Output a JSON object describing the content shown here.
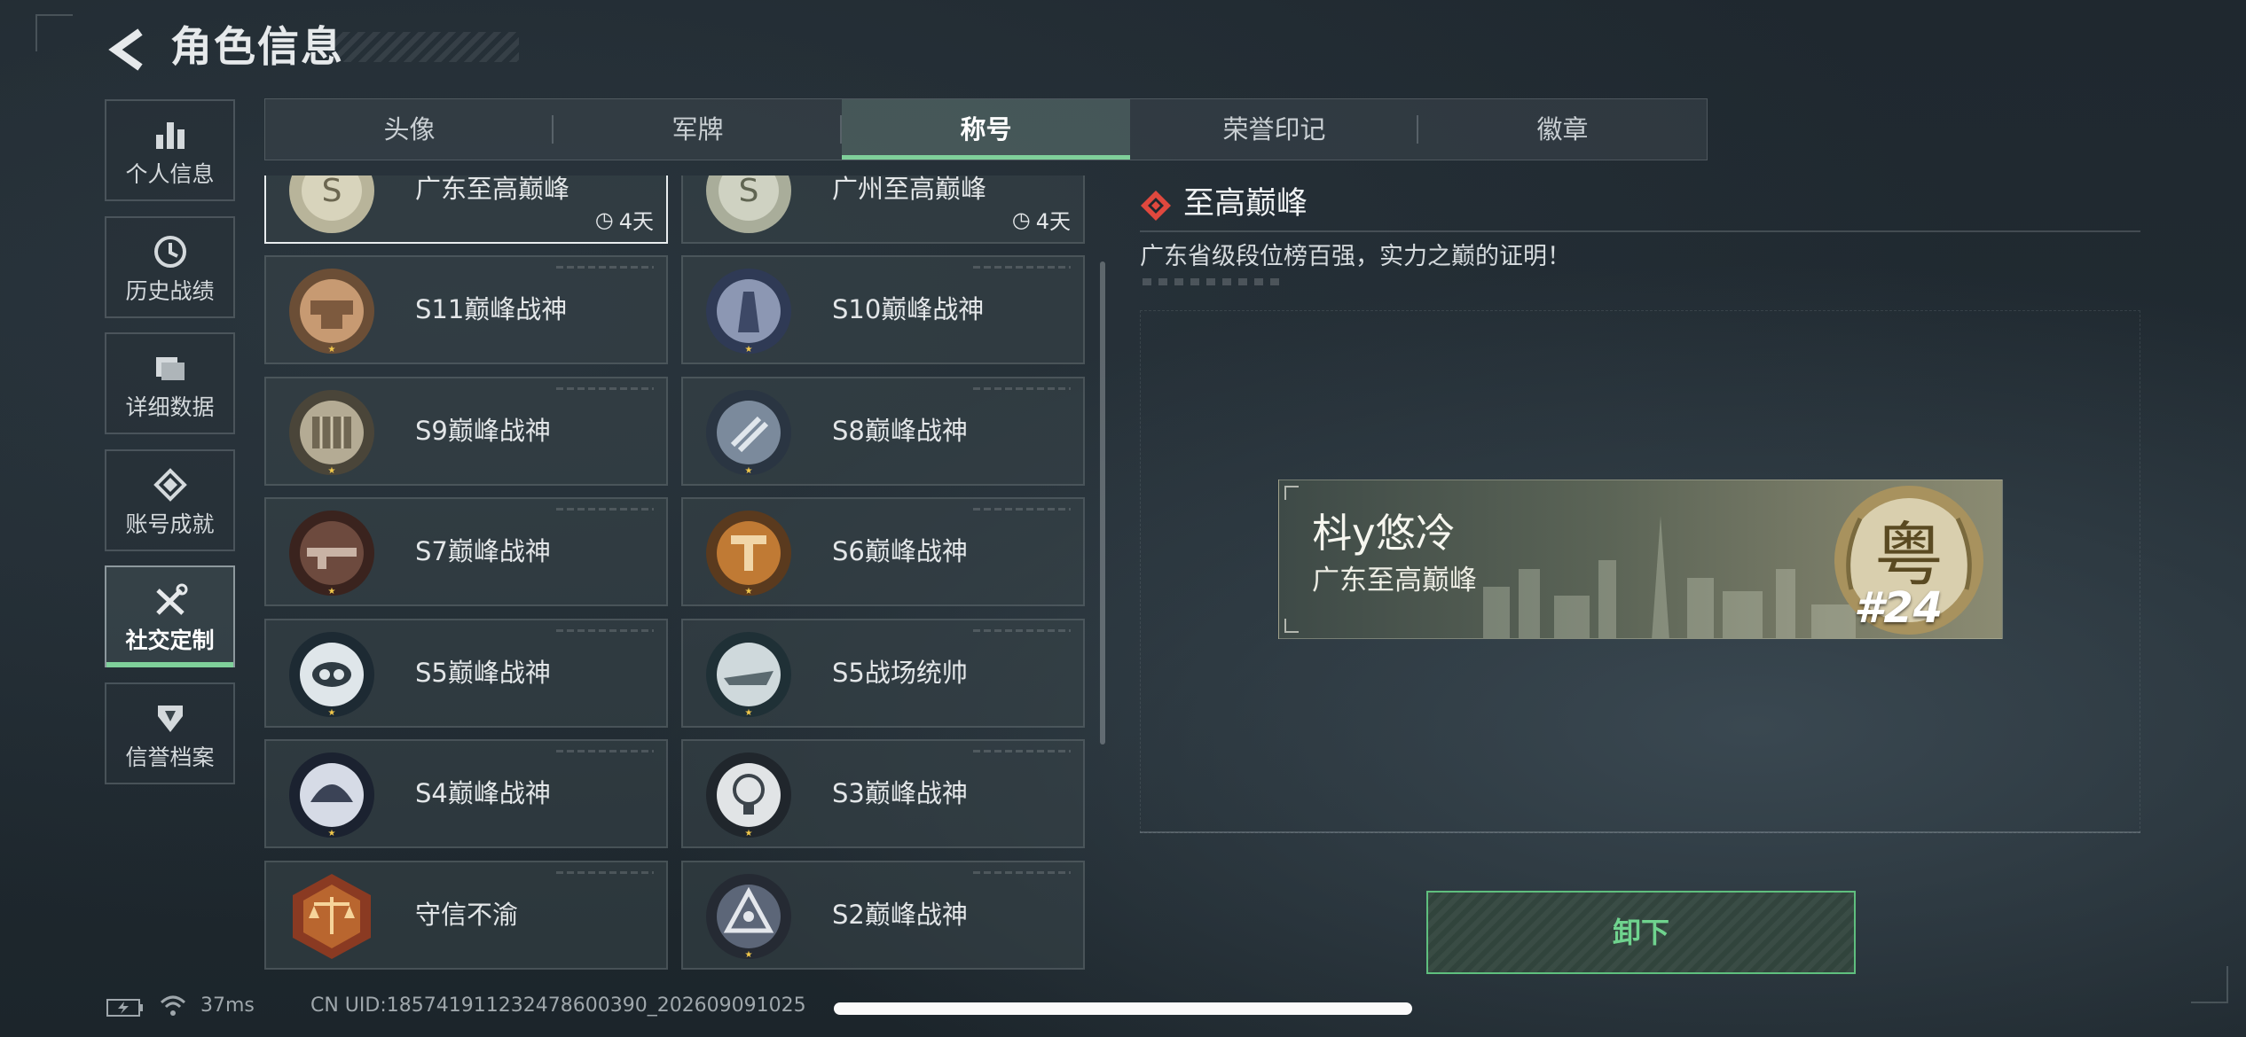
{
  "header": {
    "title": "角色信息"
  },
  "sidebar": {
    "items": [
      {
        "label": "个人信息",
        "icon": "bar-chart-icon"
      },
      {
        "label": "历史战绩",
        "icon": "clock-history-icon"
      },
      {
        "label": "详细数据",
        "icon": "folder-icon"
      },
      {
        "label": "账号成就",
        "icon": "achievement-icon"
      },
      {
        "label": "社交定制",
        "icon": "tools-icon",
        "active": true
      },
      {
        "label": "信誉档案",
        "icon": "credit-shield-icon"
      }
    ]
  },
  "tabs": [
    {
      "label": "头像"
    },
    {
      "label": "军牌"
    },
    {
      "label": "称号",
      "active": true
    },
    {
      "label": "荣誉印记"
    },
    {
      "label": "徽章"
    }
  ],
  "titles_list": [
    {
      "name": "广东至高巅峰",
      "time": "4天",
      "selected": true
    },
    {
      "name": "广州至高巅峰",
      "time": "4天"
    },
    {
      "name": "S11巅峰战神"
    },
    {
      "name": "S10巅峰战神"
    },
    {
      "name": "S9巅峰战神"
    },
    {
      "name": "S8巅峰战神"
    },
    {
      "name": "S7巅峰战神"
    },
    {
      "name": "S6巅峰战神"
    },
    {
      "name": "S5巅峰战神"
    },
    {
      "name": "S5战场统帅"
    },
    {
      "name": "S4巅峰战神"
    },
    {
      "name": "S3巅峰战神"
    },
    {
      "name": "守信不渝"
    },
    {
      "name": "S2巅峰战神"
    }
  ],
  "detail": {
    "title": "至高巅峰",
    "description": "广东省级段位榜百强，实力之巅的证明！",
    "banner": {
      "player_name": "枓y悠冷",
      "title": "广东至高巅峰",
      "rank": "#24",
      "emblem_char": "粤"
    },
    "action_label": "卸下"
  },
  "footer": {
    "ping": "37ms",
    "uid": "CN UID:1857419112324786003​90_202609091025"
  },
  "colors": {
    "accent": "#7fd09a",
    "button_text": "#6fd38e"
  }
}
